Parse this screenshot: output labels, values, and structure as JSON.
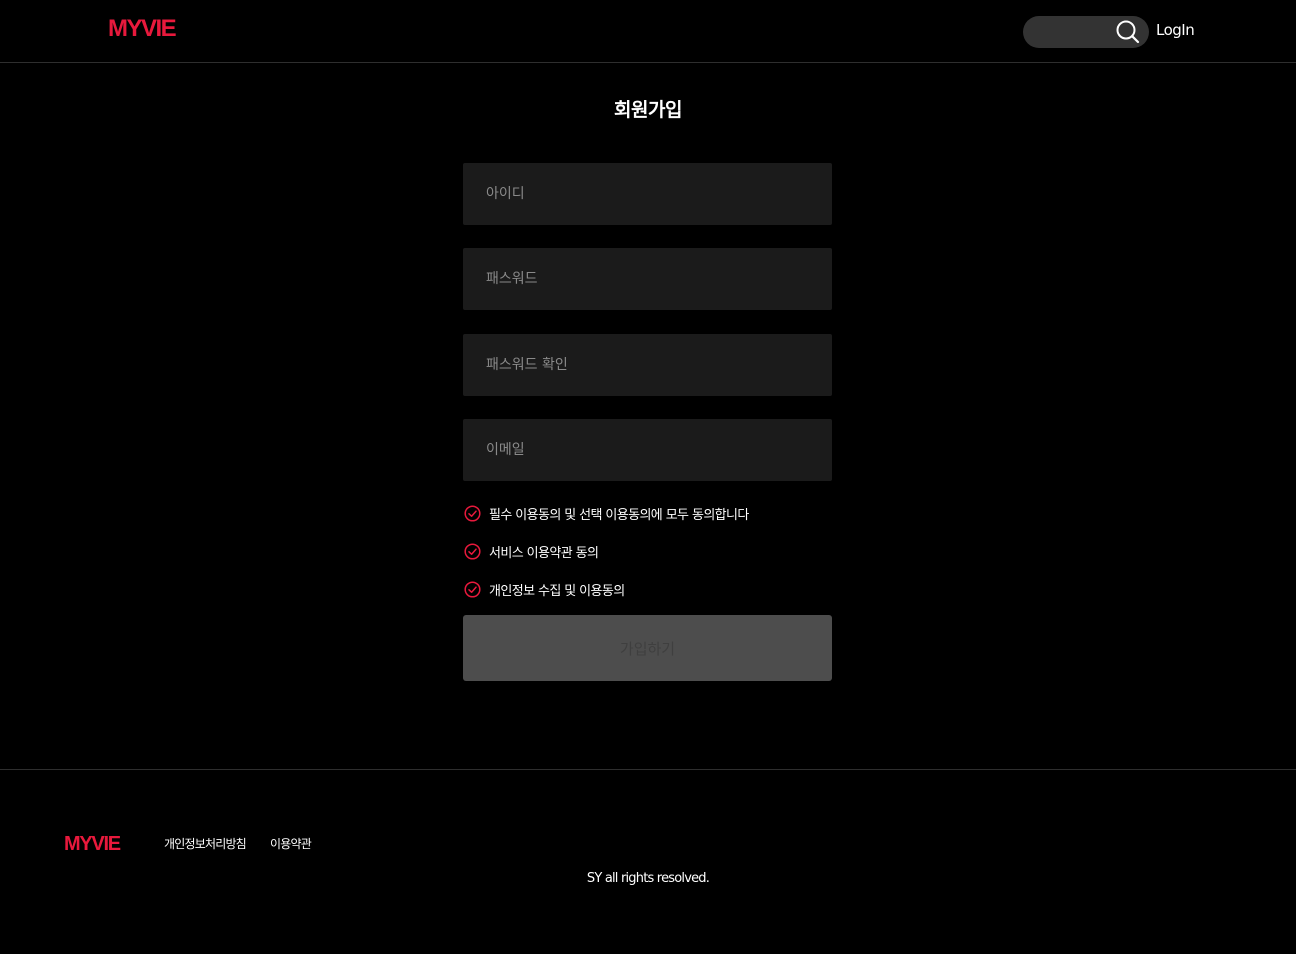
{
  "header": {
    "logo": "MYVIE",
    "search": {
      "value": "",
      "placeholder": ""
    },
    "login_label": "LogIn"
  },
  "signup": {
    "title": "회원가입",
    "fields": {
      "id_placeholder": "아이디",
      "password_placeholder": "패스워드",
      "password_confirm_placeholder": "패스워드 확인",
      "email_placeholder": "이메일"
    },
    "agreements": [
      {
        "label": "필수 이용동의 및 선택 이용동의에 모두 동의합니다"
      },
      {
        "label": "서비스 이용약관 동의"
      },
      {
        "label": "개인정보 수집 및 이용동의"
      }
    ],
    "submit_label": "가입하기"
  },
  "footer": {
    "logo": "MYVIE",
    "links": [
      "개인정보처리방침",
      "이용약관"
    ],
    "copyright": "SY all rights resolved."
  },
  "colors": {
    "brand": "#e8193c",
    "background": "#000000",
    "input_bg": "#1b1b1b",
    "button_disabled_bg": "#4d4d4d"
  }
}
